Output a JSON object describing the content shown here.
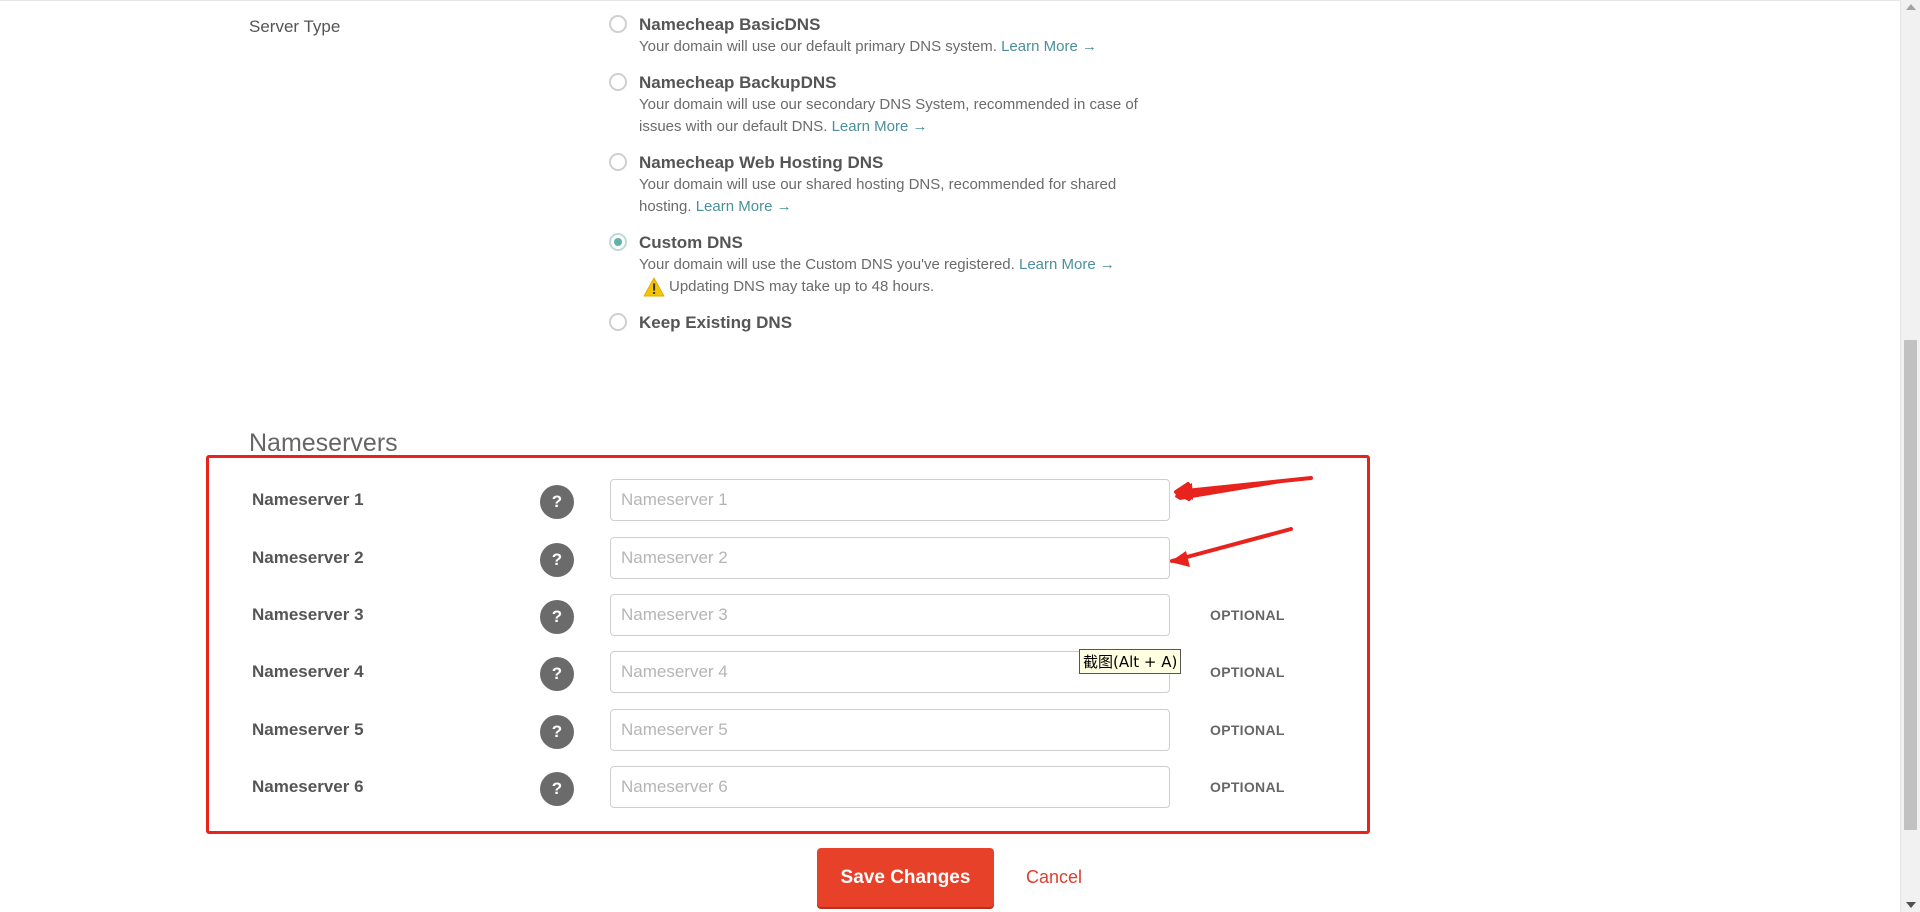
{
  "server_type": {
    "label": "Server Type",
    "options": [
      {
        "title": "Namecheap BasicDNS",
        "desc": "Your domain will use our default primary DNS system.",
        "link": "Learn More →",
        "checked": false
      },
      {
        "title": "Namecheap BackupDNS",
        "desc": "Your domain will use our secondary DNS System, recommended in case of issues with our default DNS.",
        "link": "Learn More →",
        "checked": false
      },
      {
        "title": "Namecheap Web Hosting DNS",
        "desc": "Your domain will use our shared hosting DNS, recommended for shared hosting.",
        "link": "Learn More →",
        "checked": false
      },
      {
        "title": "Custom DNS",
        "desc": "Your domain will use the Custom DNS you've registered.",
        "link": "Learn More →",
        "warning": "Updating DNS may take up to 48 hours.",
        "checked": true
      },
      {
        "title": "Keep Existing DNS",
        "checked": false
      }
    ]
  },
  "nameservers": {
    "heading": "Nameservers",
    "rows": [
      {
        "label": "Nameserver 1",
        "placeholder": "Nameserver 1",
        "value": "",
        "optional": ""
      },
      {
        "label": "Nameserver 2",
        "placeholder": "Nameserver 2",
        "value": "",
        "optional": ""
      },
      {
        "label": "Nameserver 3",
        "placeholder": "Nameserver 3",
        "value": "",
        "optional": "OPTIONAL"
      },
      {
        "label": "Nameserver 4",
        "placeholder": "Nameserver 4",
        "value": "",
        "optional": "OPTIONAL"
      },
      {
        "label": "Nameserver 5",
        "placeholder": "Nameserver 5",
        "value": "",
        "optional": "OPTIONAL"
      },
      {
        "label": "Nameserver 6",
        "placeholder": "Nameserver 6",
        "value": "",
        "optional": "OPTIONAL"
      }
    ],
    "help_glyph": "?"
  },
  "tooltip": "截图(Alt + A)",
  "actions": {
    "save_label": "Save Changes",
    "cancel_label": "Cancel"
  },
  "colors": {
    "accent": "#e8412a",
    "highlight_box": "#e8231e",
    "link": "#4a8f9b",
    "radio_checked": "#5fb3ad"
  },
  "icons": {
    "warning": "warning-icon",
    "help": "help-icon"
  }
}
